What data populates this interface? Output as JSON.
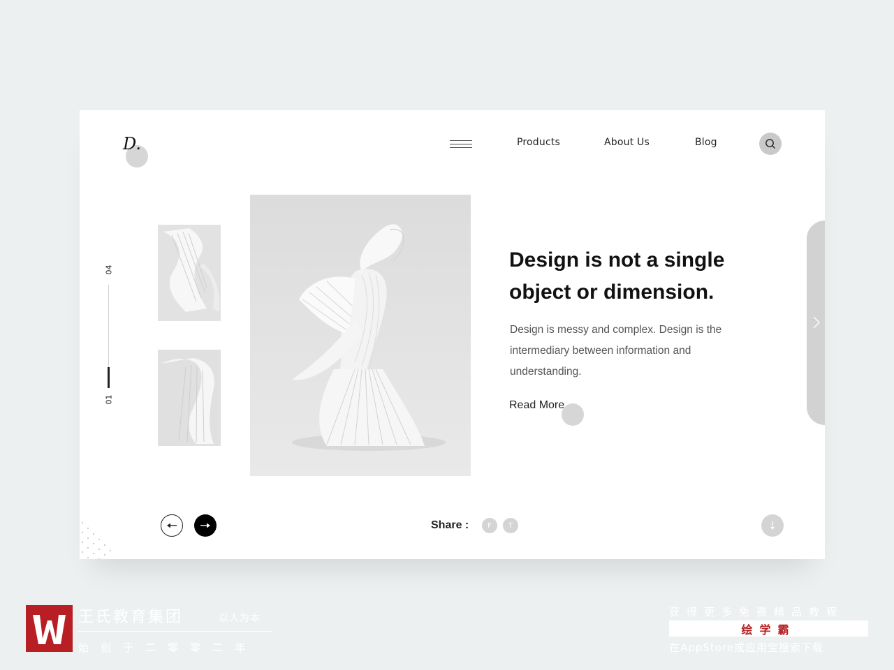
{
  "header": {
    "logo": "D.",
    "nav": [
      "Products",
      "About Us",
      "Blog"
    ]
  },
  "slider": {
    "index_start": "01",
    "index_end": "04",
    "progress": 0.25
  },
  "hero": {
    "headline_line1": "Design is not a single",
    "headline_line2": "object or dimension.",
    "body": "Design is messy and complex. Design is the intermediary between information and understanding.",
    "cta": "Read More"
  },
  "footer": {
    "share_label": "Share :",
    "social": [
      "F",
      "T"
    ]
  },
  "watermark": {
    "org": "王氏教育集团",
    "motto": "以人为本",
    "founded": "始创于二零零二年",
    "promo_line1": "获得更多免费精品教程",
    "promo_brand": "绘学霸",
    "promo_line3": "在AppStore或应用宝搜索下载"
  },
  "colors": {
    "background": "#edf0f1",
    "card": "#ffffff",
    "accent": "#000000",
    "brand_red": "#b71f24"
  }
}
